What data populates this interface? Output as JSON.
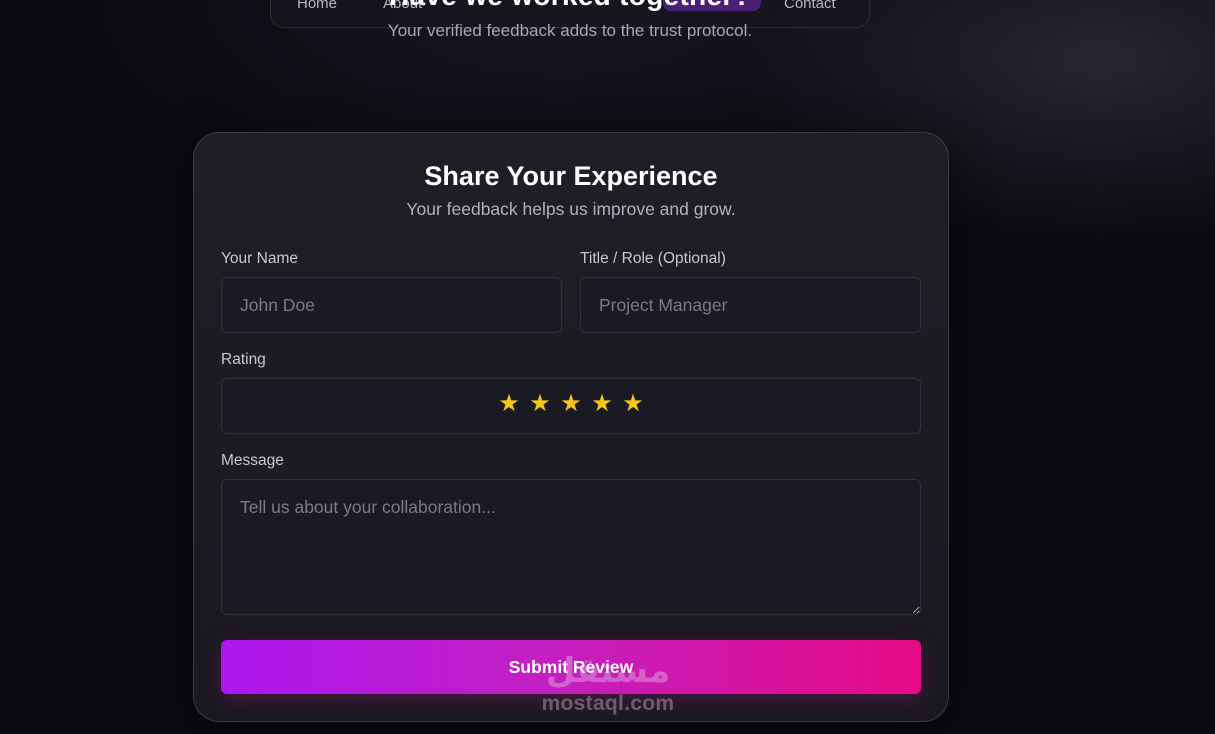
{
  "nav": {
    "items": [
      "Home",
      "About",
      "Contact"
    ]
  },
  "hero": {
    "title": "Have we worked together?",
    "subtitle": "Your verified feedback adds to the trust protocol."
  },
  "form": {
    "title": "Share Your Experience",
    "subtitle": "Your feedback helps us improve and grow.",
    "name_label": "Your Name",
    "name_placeholder": "John Doe",
    "role_label": "Title / Role (Optional)",
    "role_placeholder": "Project Manager",
    "rating_label": "Rating",
    "rating_max": 5,
    "rating_value": 5,
    "star_glyph": "★",
    "star_color": "#f5c518",
    "message_label": "Message",
    "message_placeholder": "Tell us about your collaboration...",
    "submit_label": "Submit Review",
    "submit_gradient": [
      "#ae17f0",
      "#e60b85"
    ]
  },
  "watermark": {
    "text": "mostaql.com",
    "logo_text": "مستقل"
  }
}
